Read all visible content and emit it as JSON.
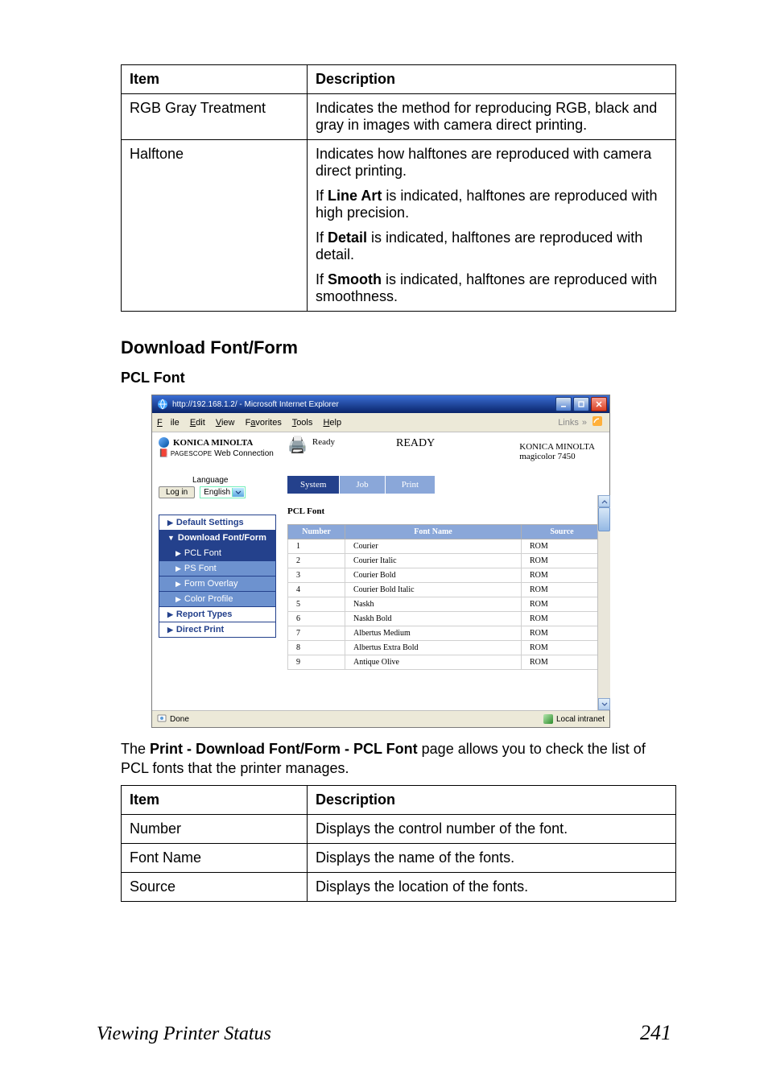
{
  "table1": {
    "head_item": "Item",
    "head_desc": "Description",
    "row1_item": "RGB Gray Treatment",
    "row1_desc": "Indicates the method for reproducing RGB, black and gray in images with camera direct printing.",
    "row2_item": "Halftone",
    "row2_p1": "Indicates how halftones are reproduced with camera direct printing.",
    "row2_p2a": "If ",
    "row2_p2b": "Line Art",
    "row2_p2c": " is indicated, halftones are reproduced with high precision.",
    "row2_p3a": "If ",
    "row2_p3b": "Detail",
    "row2_p3c": " is indicated, halftones are reproduced with detail.",
    "row2_p4a": "If ",
    "row2_p4b": "Smooth",
    "row2_p4c": " is indicated, halftones are reproduced with smoothness."
  },
  "section_heading": "Download Font/Form",
  "sub_heading": "PCL Font",
  "shot": {
    "title": "http://192.168.1.2/ - Microsoft Internet Explorer",
    "menu_file": "File",
    "menu_edit": "Edit",
    "menu_view": "View",
    "menu_fav": "Favorites",
    "menu_tools": "Tools",
    "menu_help": "Help",
    "links_label": "Links",
    "brand": "KONICA MINOLTA",
    "pagescope_a": "PAGE",
    "pagescope_b": "SCOPE",
    "pagescope_c": " Web Connection",
    "language_label": "Language",
    "login_label": "Log in",
    "lang_value": "English",
    "ready_small": "Ready",
    "ready_big": "READY",
    "model_line1": "KONICA MINOLTA",
    "model_line2": "magicolor 7450",
    "tab_system": "System",
    "tab_job": "Job",
    "tab_print": "Print",
    "side": {
      "default_settings": "Default Settings",
      "download_ff": "Download Font/Form",
      "pcl_font": "PCL Font",
      "ps_font": "PS Font",
      "form_overlay": "Form Overlay",
      "color_profile": "Color Profile",
      "report_types": "Report Types",
      "direct_print": "Direct Print"
    },
    "list_title": "PCL Font",
    "th_number": "Number",
    "th_fontname": "Font Name",
    "th_source": "Source",
    "rows": [
      {
        "n": "1",
        "name": "Courier",
        "src": "ROM"
      },
      {
        "n": "2",
        "name": "Courier Italic",
        "src": "ROM"
      },
      {
        "n": "3",
        "name": "Courier Bold",
        "src": "ROM"
      },
      {
        "n": "4",
        "name": "Courier Bold Italic",
        "src": "ROM"
      },
      {
        "n": "5",
        "name": "Naskh",
        "src": "ROM"
      },
      {
        "n": "6",
        "name": "Naskh Bold",
        "src": "ROM"
      },
      {
        "n": "7",
        "name": "Albertus Medium",
        "src": "ROM"
      },
      {
        "n": "8",
        "name": "Albertus Extra Bold",
        "src": "ROM"
      },
      {
        "n": "9",
        "name": "Antique Olive",
        "src": "ROM"
      }
    ],
    "status_done": "Done",
    "status_zone": "Local intranet"
  },
  "para": {
    "a": "The ",
    "b": "Print - Download Font/Form - PCL Font",
    "c": " page allows you to check the list of PCL fonts that the printer manages."
  },
  "table2": {
    "head_item": "Item",
    "head_desc": "Description",
    "r1_item": "Number",
    "r1_desc": "Displays the control number of the font.",
    "r2_item": "Font Name",
    "r2_desc": "Displays the name of the fonts.",
    "r3_item": "Source",
    "r3_desc": "Displays the location of the fonts."
  },
  "footer_left": "Viewing Printer Status",
  "footer_right": "241"
}
